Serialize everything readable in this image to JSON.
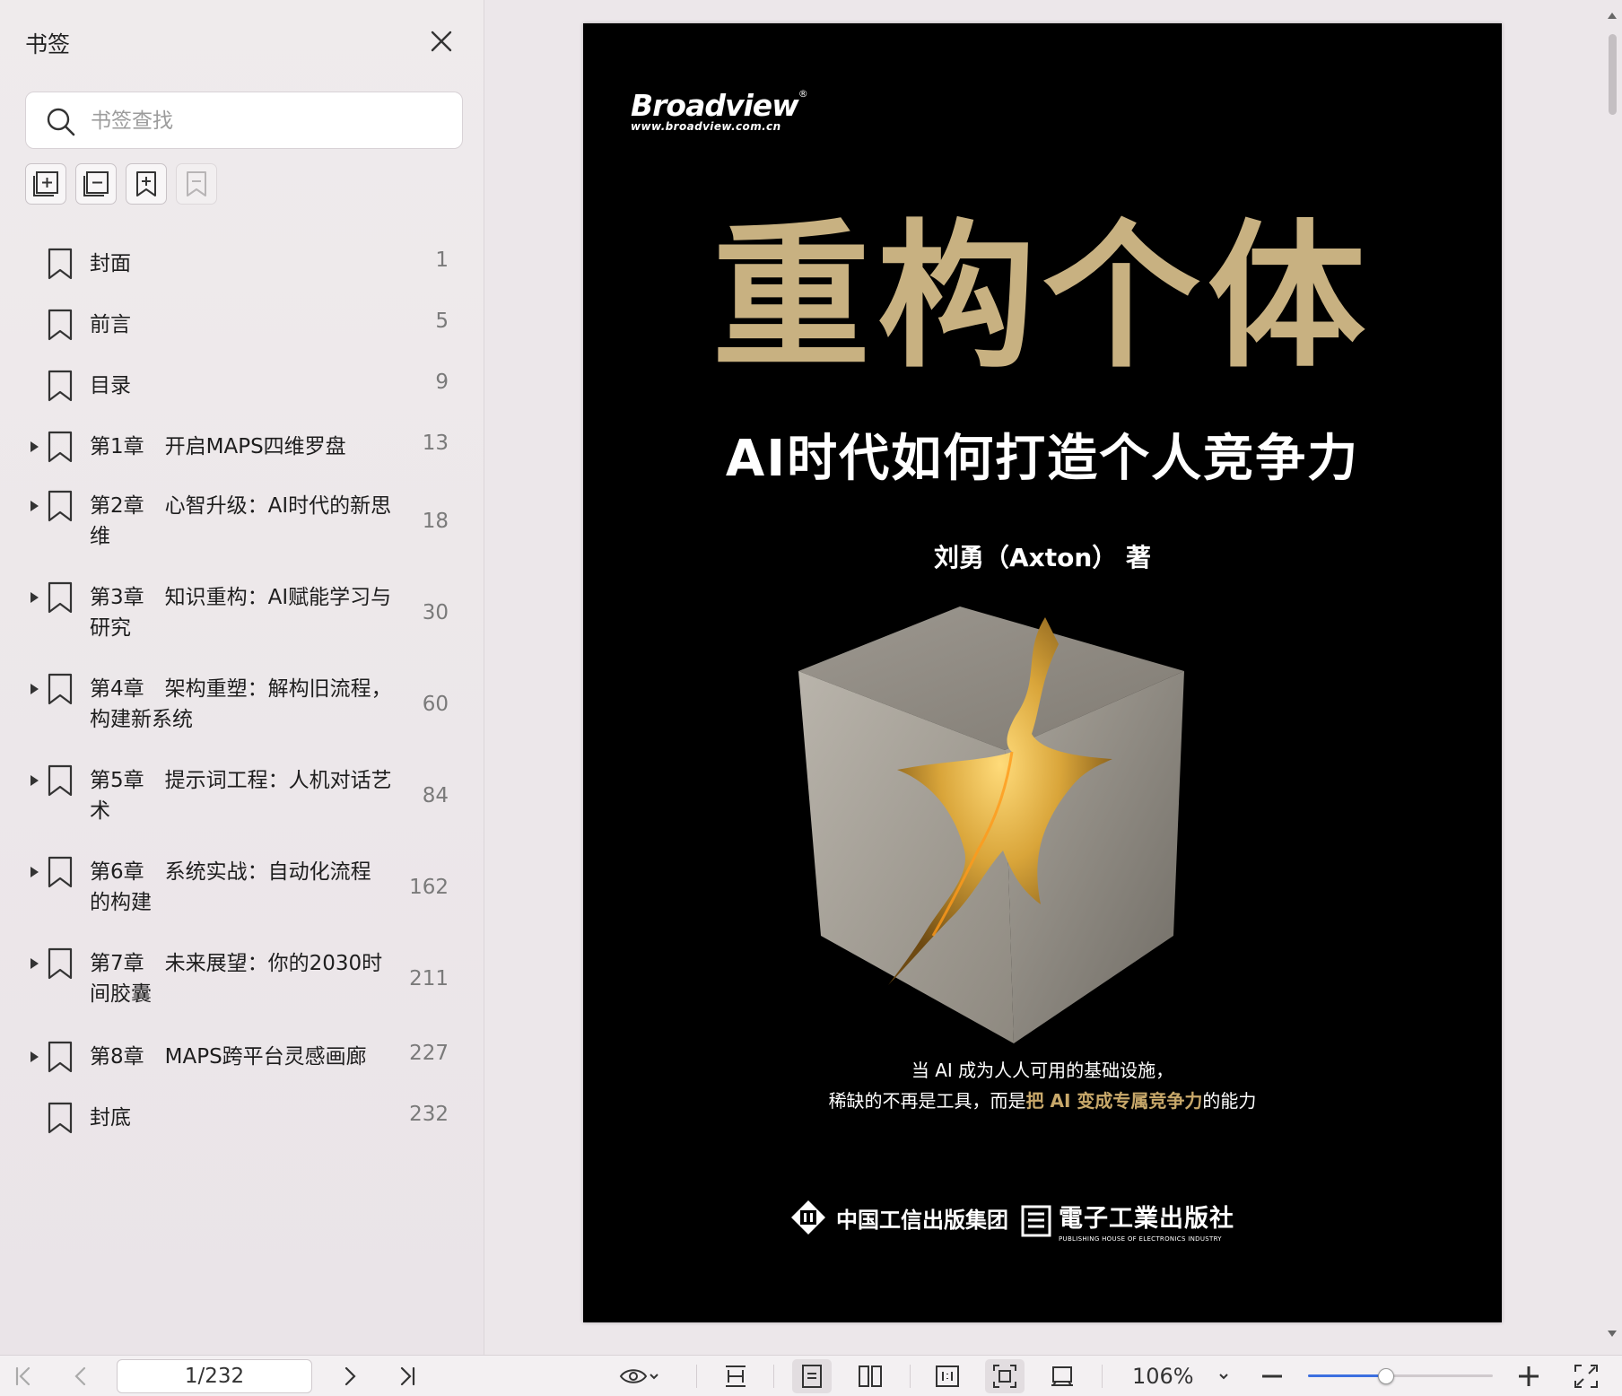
{
  "sidebar": {
    "title": "书签",
    "search": {
      "placeholder": "书签查找",
      "value": ""
    },
    "items": [
      {
        "label": "封面",
        "page": "1",
        "expandable": false
      },
      {
        "label": "前言",
        "page": "5",
        "expandable": false
      },
      {
        "label": "目录",
        "page": "9",
        "expandable": false
      },
      {
        "label": "第1章　开启MAPS四维罗盘",
        "page": "13",
        "expandable": true
      },
      {
        "label": "第2章　心智升级：AI时代的新思\n维",
        "page": "18",
        "expandable": true
      },
      {
        "label": "第3章　知识重构：AI赋能学习与\n研究",
        "page": "30",
        "expandable": true
      },
      {
        "label": "第4章　架构重塑：解构旧流程，\n构建新系统",
        "page": "60",
        "expandable": true
      },
      {
        "label": "第5章　提示词工程：人机对话艺\n术",
        "page": "84",
        "expandable": true
      },
      {
        "label": "第6章　系统实战：自动化流程\n的构建",
        "page": "162",
        "expandable": true
      },
      {
        "label": "第7章　未来展望：你的2030时\n间胶囊",
        "page": "211",
        "expandable": true
      },
      {
        "label": "第8章　MAPS跨平台灵感画廊",
        "page": "227",
        "expandable": true
      },
      {
        "label": "封底",
        "page": "232",
        "expandable": false
      }
    ]
  },
  "cover": {
    "brand": "Broadview",
    "brand_reg": "®",
    "brand_url": "www.broadview.com.cn",
    "title": "重构个体",
    "subtitle": "AI时代如何打造个人竞争力",
    "author": "刘勇（Axton）  著",
    "tagline_line1": "当 AI 成为人人可用的基础设施，",
    "tagline_line2_pre": "稀缺的不再是工具，而是",
    "tagline_line2_gold": "把 AI 变成专属竞争力",
    "tagline_line2_post": "的能力",
    "publisher1": "中国工信出版集团",
    "publisher2": "電子工業出版社",
    "publisher2_en": "PUBLISHING HOUSE OF ELECTRONICS INDUSTRY",
    "gold_color": "#c8b181"
  },
  "toolbar": {
    "page_indicator": "1/232",
    "zoom": "106%",
    "zoom_fraction": 0.42
  }
}
